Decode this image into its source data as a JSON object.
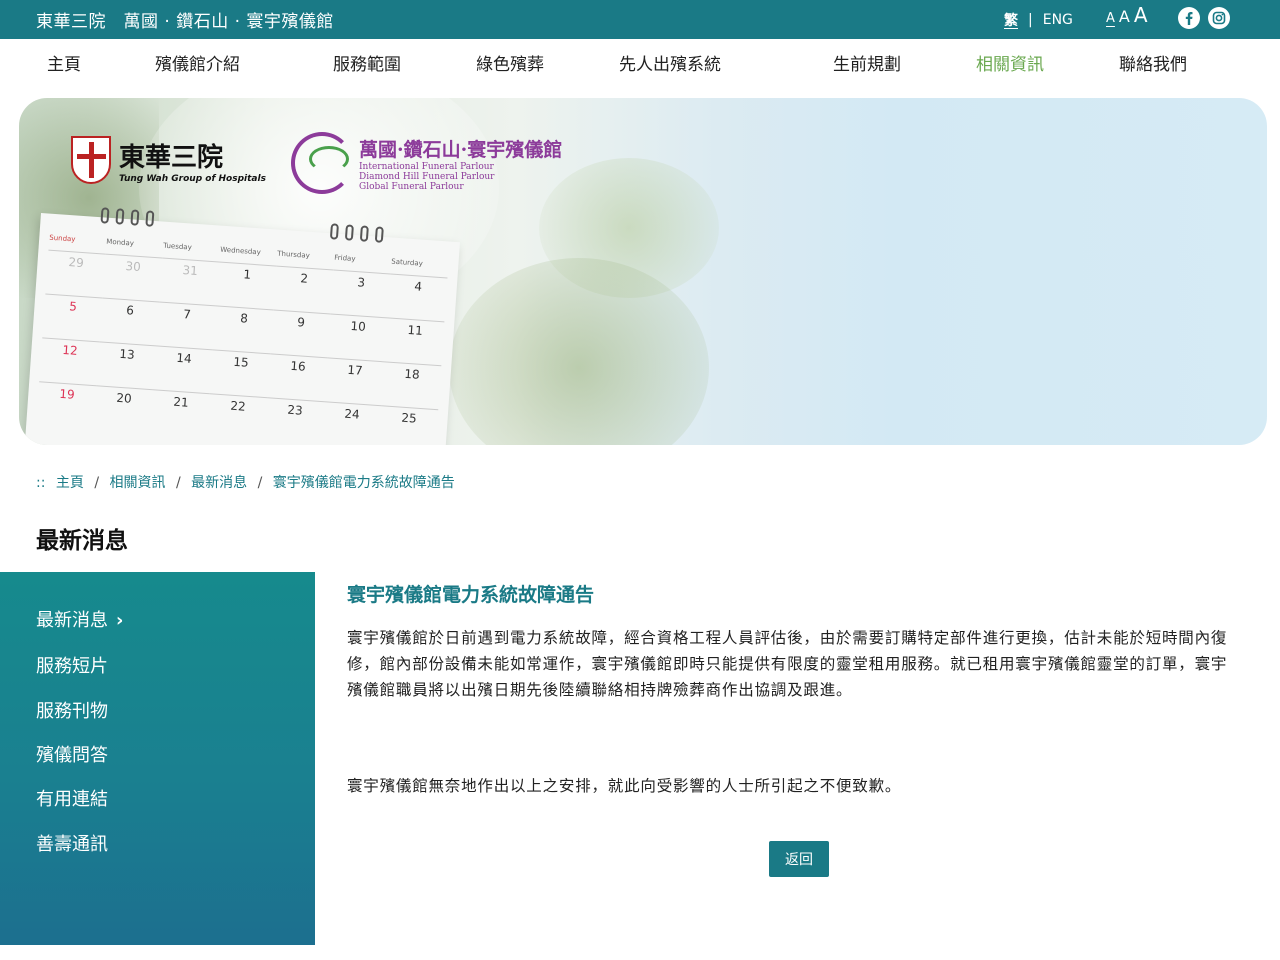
{
  "topbar": {
    "site_title": "東華三院　萬國 · 鑽石山 · 寰宇殯儀館",
    "lang_zh": "繁",
    "lang_sep": "|",
    "lang_en": "ENG",
    "font_small": "A",
    "font_medium": "A",
    "font_large": "A",
    "social": [
      "facebook-icon",
      "instagram-icon"
    ]
  },
  "nav": {
    "items": [
      "主頁",
      "殯儀館介紹",
      "服務範圍",
      "綠色殯葬",
      "先人出殯系統",
      "生前規劃",
      "相關資訊",
      "聯絡我們"
    ],
    "active": "相關資訊",
    "active_color": "#6aa84f"
  },
  "banner": {
    "logo_twgh_zh": "東華三院",
    "logo_twgh_en": "Tung Wah Group of Hospitals",
    "logo_parlour_zh": "萬國·鑽石山·寰宇殯儀館",
    "logo_parlour_en": [
      "International Funeral Parlour",
      "Diamond Hill Funeral Parlour",
      "Global Funeral Parlour"
    ],
    "calendar_days": [
      "Sunday",
      "Monday",
      "Tuesday",
      "Wednesday",
      "Thursday",
      "Friday",
      "Saturday"
    ],
    "calendar_dates": [
      "29",
      "30",
      "31",
      "1",
      "2",
      "3",
      "4",
      "5",
      "6",
      "7",
      "8",
      "9",
      "10",
      "11",
      "12",
      "13",
      "14",
      "15",
      "16",
      "17",
      "18",
      "19",
      "20",
      "21",
      "22",
      "23",
      "24",
      "25"
    ]
  },
  "breadcrumb": {
    "prefix": "::",
    "items": [
      "主頁",
      "相關資訊",
      "最新消息"
    ],
    "separator": "/",
    "current": "寰宇殯儀館電力系統故障通告"
  },
  "page_title": "最新消息",
  "sidebar": {
    "items": [
      "最新消息",
      "服務短片",
      "服務刊物",
      "殯儀問答",
      "有用連結",
      "善壽通訊"
    ],
    "active_chevron": "›"
  },
  "article": {
    "title": "寰宇殯儀館電力系統故障通告",
    "body": "寰宇殯儀館於日前遇到電力系統故障，經合資格工程人員評估後，由於需要訂購特定部件進行更換，估計未能於短時間內復修，館內部份設備未能如常運作，寰宇殯儀館即時只能提供有限度的靈堂租用服務。就已租用寰宇殯儀館靈堂的訂單，寰宇殯儀館職員將以出殯日期先後陸續聯絡相持牌殮葬商作出協調及跟進。",
    "footer": "寰宇殯儀館無奈地作出以上之安排，就此向受影響的人士所引起之不便致歉。",
    "back_label": "返回"
  },
  "colors": {
    "brand": "#1a7a86",
    "sidebar_bottom": "#1c6f8f"
  }
}
